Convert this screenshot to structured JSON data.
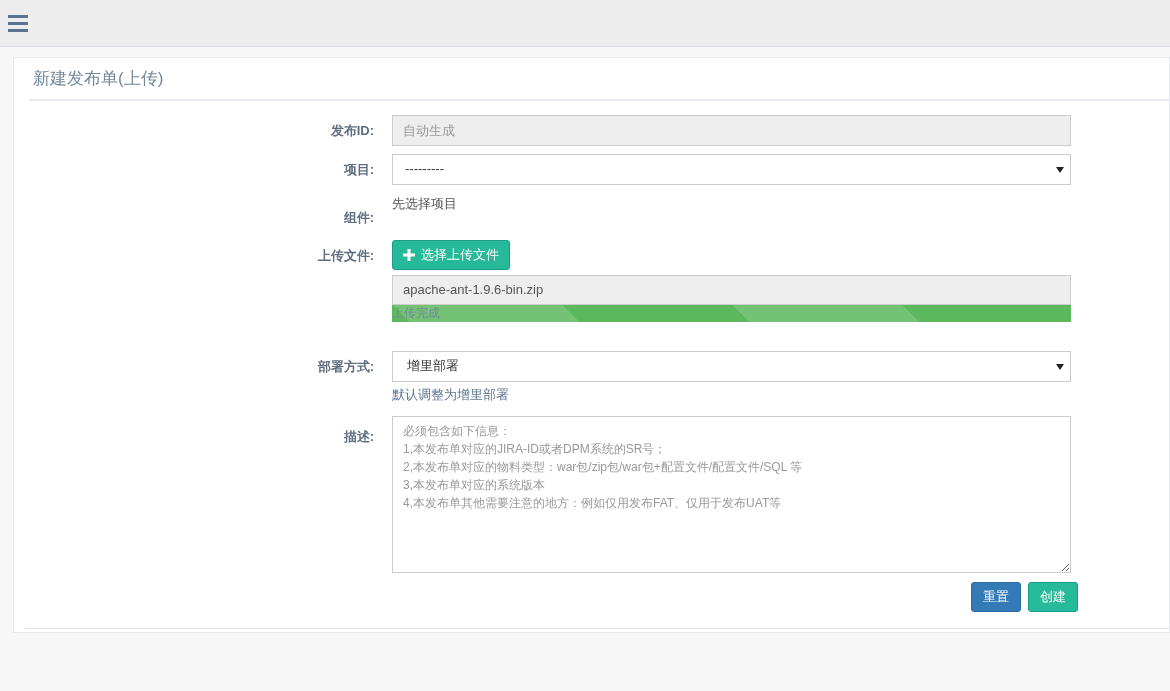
{
  "page_title": "新建发布单(上传)",
  "release_id": {
    "label": "发布ID:",
    "placeholder": "自动生成",
    "disabled": true
  },
  "project": {
    "label": "项目:",
    "value": "---------"
  },
  "component": {
    "label": "组件:",
    "text": "先选择项目"
  },
  "upload": {
    "label": "上传文件:",
    "button": "选择上传文件",
    "file_name": "apache-ant-1.9.6-bin.zip",
    "progress": {
      "level": 1,
      "text": "上传完成"
    }
  },
  "deploy_mode": {
    "label": "部署方式:",
    "value": "增里部署",
    "hint": "默认调整为增里部署"
  },
  "description": {
    "label": "描述:",
    "placeholder": "必须包含如下信息：\n1,本发布单对应的JIRA-ID或者DPM系统的SR号；\n2,本发布单对应的物料类型：war包/zip包/war包+配置文件/配置文件/SQL 等\n3,本发布单对应的系统版本\n4,本发布单其他需要注意的地方：例如仅用发布FAT、仅用于发布UAT等"
  },
  "buttons": [
    {
      "kind": "reset",
      "label": "重置"
    },
    {
      "kind": "create",
      "label": "创建"
    }
  ]
}
